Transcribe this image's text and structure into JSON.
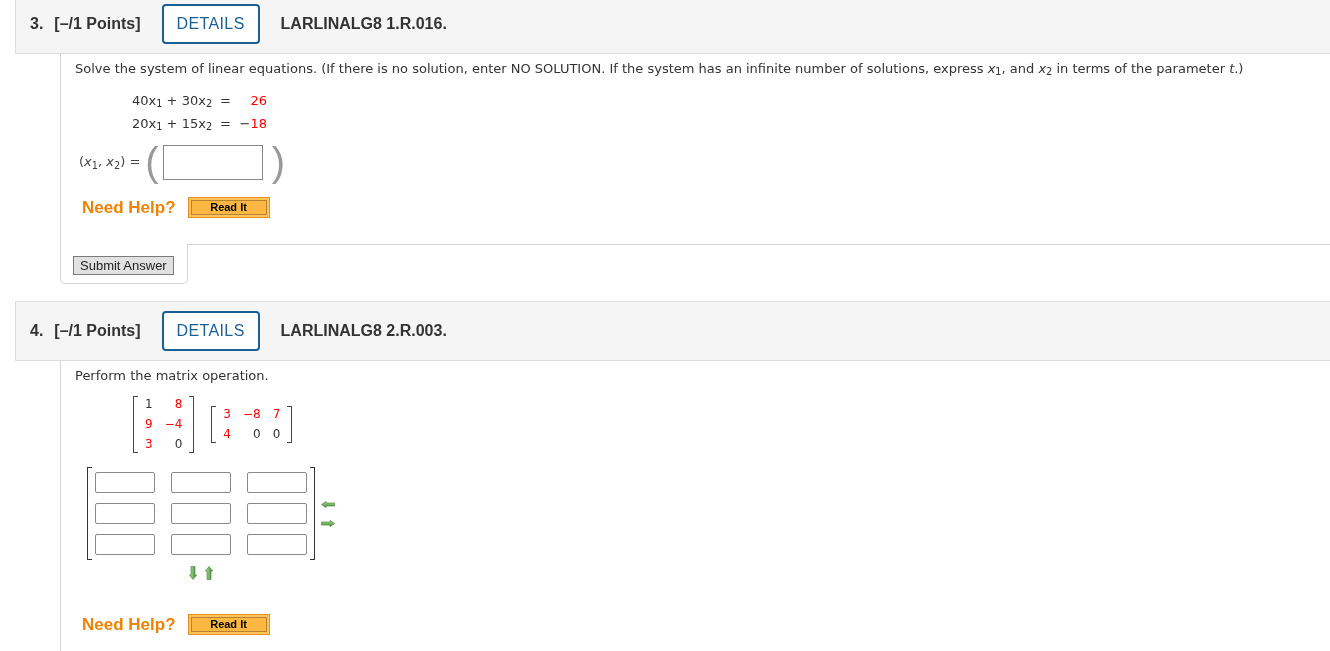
{
  "questions": [
    {
      "number": "3.",
      "points": "[–/1 Points]",
      "details_button": "DETAILS",
      "code": "LARLINALG8 1.R.016.",
      "prompt": "Solve the system of linear equations. (If there is no solution, enter NO SOLUTION. If the system has an infinite number of solutions, express *x*$_{1}$, and *x*$_{2}$ in terms of the parameter *t*.)",
      "equations": [
        {
          "left": "40x$_{1}$ + 30x$_{2}$",
          "equals": "=",
          "value": "26"
        },
        {
          "left": "20x$_{1}$ + 15x$_{2}$",
          "equals": "=",
          "sign": "−",
          "value": "18"
        }
      ],
      "answer": {
        "label": "(*x*$_{1}$, *x*$_{2}$) =",
        "open": "(",
        "close": ")"
      },
      "help": {
        "label": "Need Help?",
        "buttons": [
          "Read It"
        ]
      },
      "submit_button": "Submit Answer"
    },
    {
      "number": "4.",
      "points": "[–/1 Points]",
      "details_button": "DETAILS",
      "code": "LARLINALG8 2.R.003.",
      "prompt": "Perform the matrix operation.",
      "matrices": [
        {
          "rows": [
            [
              {
                "text": "1",
                "color": "#333333"
              },
              {
                "text": "8",
                "color": "#ff0000"
              }
            ],
            [
              {
                "text": "9",
                "color": "#ff0000"
              },
              {
                "text": "−4",
                "color": "#ff0000"
              }
            ],
            [
              {
                "text": "3",
                "color": "#ff0000"
              },
              {
                "text": "0",
                "color": "#333333"
              }
            ]
          ]
        },
        {
          "rows": [
            [
              {
                "text": "3",
                "color": "#ff0000"
              },
              {
                "text": "−8",
                "color": "#ff0000"
              },
              {
                "text": "7",
                "color": "#ff0000"
              }
            ],
            [
              {
                "text": "4",
                "color": "#ff0000"
              },
              {
                "text": "0",
                "color": "#333333"
              },
              {
                "text": "0",
                "color": "#333333"
              }
            ]
          ]
        }
      ],
      "answer_matrix": {
        "rows": [
          [
            {
              "kind": "input"
            },
            {
              "kind": "input"
            },
            {
              "kind": "input"
            }
          ],
          [
            {
              "kind": "input"
            },
            {
              "kind": "input"
            },
            {
              "kind": "input"
            }
          ],
          [
            {
              "kind": "input"
            },
            {
              "kind": "input"
            },
            {
              "kind": "input"
            }
          ]
        ]
      },
      "help": {
        "label": "Need Help?",
        "buttons": [
          "Read It"
        ]
      }
    }
  ]
}
